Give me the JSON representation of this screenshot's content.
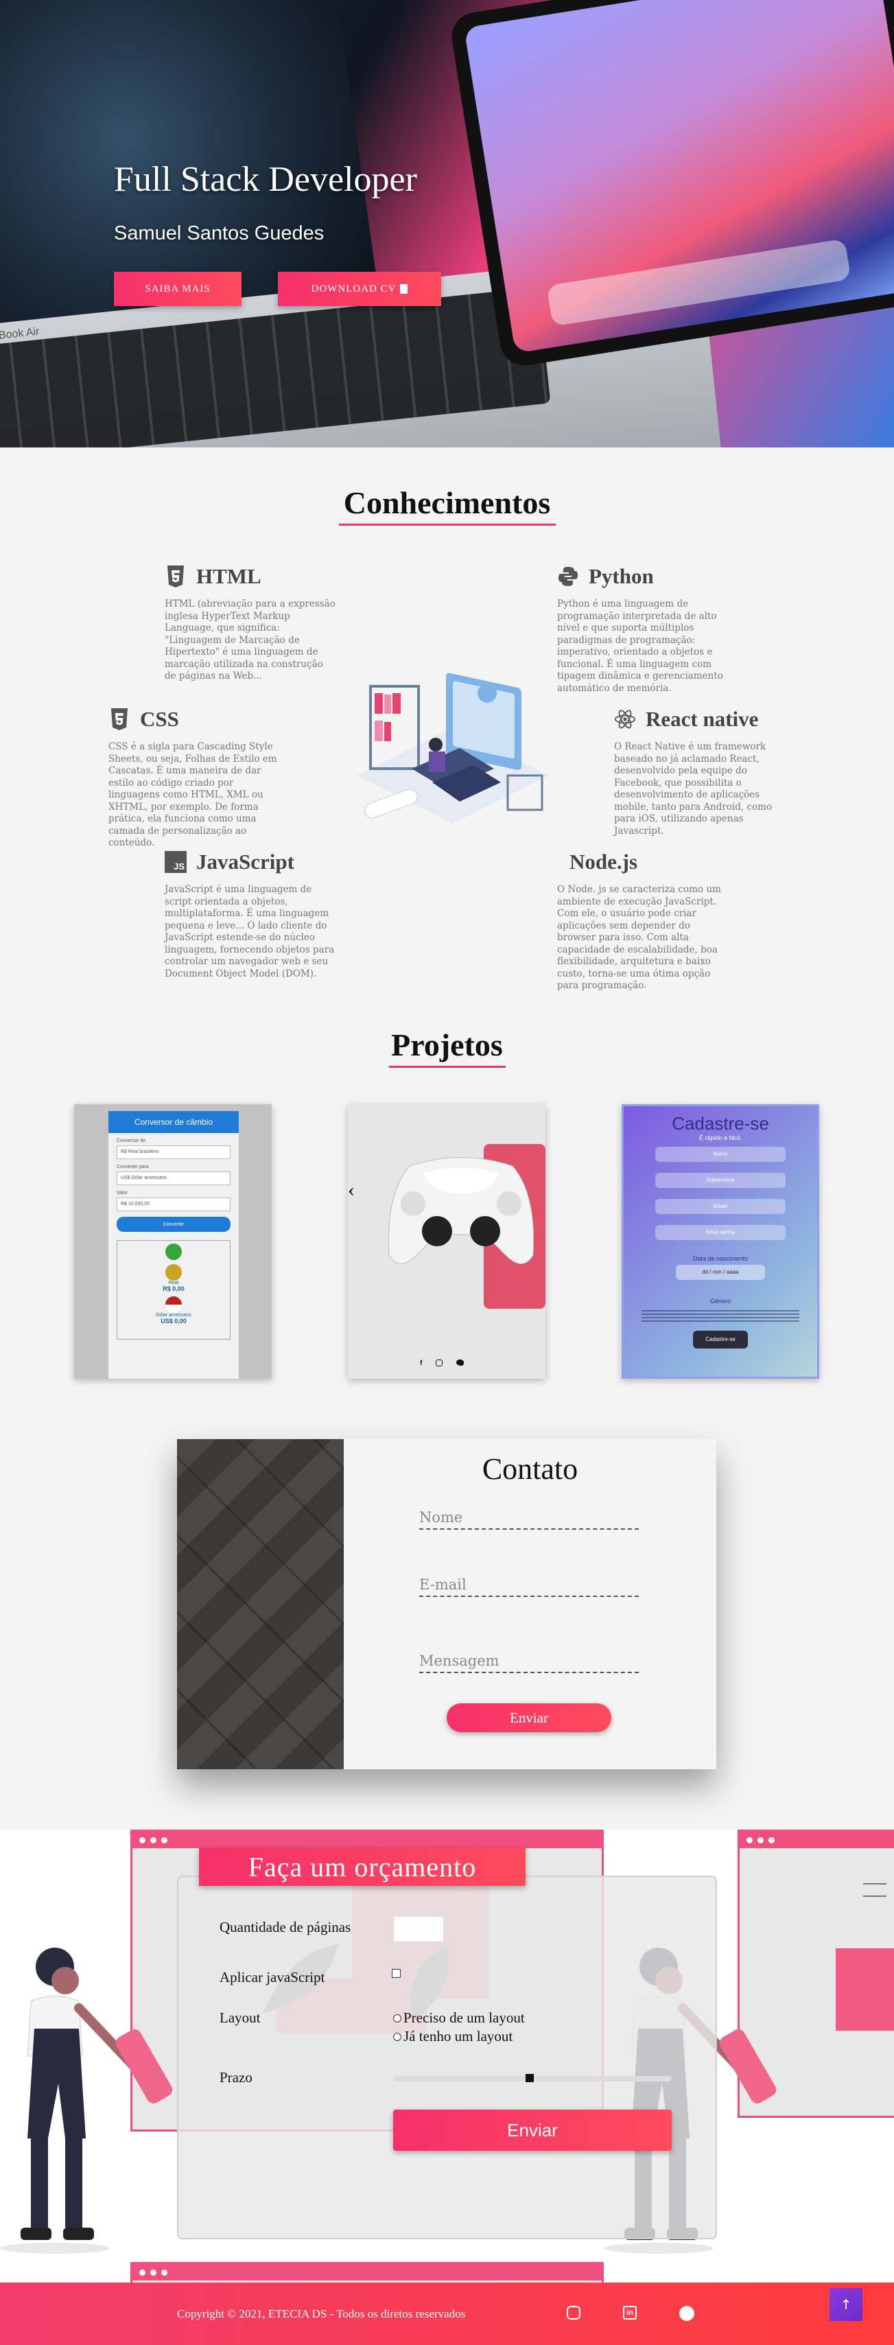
{
  "hero": {
    "title": "Full Stack Developer",
    "subtitle": "Samuel Santos Guedes",
    "btn_more": "SAIBA MAIS",
    "btn_cv": "DOWNLOAD CV",
    "laptop_brand": "MacBook Air"
  },
  "skills": {
    "title": "Conhecimentos",
    "items": [
      {
        "name": "HTML",
        "icon": "html5-icon",
        "text": "HTML (abreviação para a expressão inglesa HyperText Markup Language, que significa: \"Linguagem de Marcação de Hipertexto\" é uma linguagem de marcação utilizada na construção de páginas na Web..."
      },
      {
        "name": "Python",
        "icon": "python-icon",
        "text": "Python é uma linguagem de programação interpretada de alto nível e que suporta múltiplos paradigmas de programação: imperativo, orientado a objetos e funcional. É uma linguagem com tipagem dinâmica e gerenciamento automático de memória."
      },
      {
        "name": "CSS",
        "icon": "css3-icon",
        "text": "CSS é a sigla para Cascading Style Sheets, ou seja, Folhas de Estilo em Cascatas. É uma maneira de dar estilo ao código criado por linguagens como HTML, XML ou XHTML, por exemplo. De forma prática, ela funciona como uma camada de personalização ao conteúdo."
      },
      {
        "name": "React native",
        "icon": "react-icon",
        "text": "O React Native é um framework baseado no já aclamado React, desenvolvido pela equipe do Facebook, que possibilita o desenvolvimento de aplicações mobile, tanto para Android, como para iOS, utilizando apenas Javascript."
      },
      {
        "name": "JavaScript",
        "icon": "javascript-icon",
        "text": "JavaScript é uma linguagem de script orientada a objetos, multiplataforma. É uma linguagem pequena e leve... O lado cliente do JavaScript estende-se do núcleo linguagem, fornecendo objetos para controlar um navegador web e seu Document Object Model (DOM)."
      },
      {
        "name": "Node.js",
        "icon": "",
        "text": "O Node. js se caracteriza como um ambiente de execução JavaScript. Com ele, o usuário pode criar aplicações sem depender do browser para isso. Com alta capacidade de escalabilidade, boa flexibilidade, arquitetura e baixo custo, torna-se uma ótima opção para programação."
      }
    ]
  },
  "projects": {
    "title": "Projetos",
    "p1": {
      "header": "Conversor de câmbio",
      "label1": "Conversor de",
      "input1": "R$ Real brasileiro",
      "label2": "Converter para",
      "input2": "US$ Dólar americano",
      "label3": "Valor",
      "input3": "R$ 10.000,00",
      "button": "Converter",
      "from_label": "Real",
      "from_value": "R$ 0,00",
      "to_label": "Dólar americano",
      "to_value": "US$ 0,00"
    },
    "p2": {
      "prev": "‹"
    },
    "p3": {
      "title": "Cadastre-se",
      "sub": "É rápido e fácil.",
      "f1": "Nome",
      "f2": "Sobrenome",
      "f3": "Email",
      "f4": "Nova senha",
      "date_label": "Data de nascimento",
      "date_value": "dd / mm / aaaa",
      "gender": "Gênero",
      "button": "Cadastre-se"
    }
  },
  "contact": {
    "title": "Contato",
    "name_ph": "Nome",
    "email_ph": "E-mail",
    "msg_ph": "Mensagem",
    "send": "Enviar"
  },
  "budget": {
    "title": "Faça um orçamento",
    "pages_label": "Quantidade de páginas",
    "js_label": "Aplicar javaScript",
    "layout_label": "Layout",
    "layout_opt1": "Preciso de um layout",
    "layout_opt2": "Já tenho um layout",
    "deadline_label": "Prazo",
    "deadline_level": 0.49,
    "send": "Enviar"
  },
  "footer": {
    "copyright": "Copyright © 2021, ETECIA DS - Todos os diretos reservados"
  },
  "colors": {
    "accent": "#f0396d",
    "footer": "#ff3b3b",
    "skill_line": "#e8386d"
  }
}
